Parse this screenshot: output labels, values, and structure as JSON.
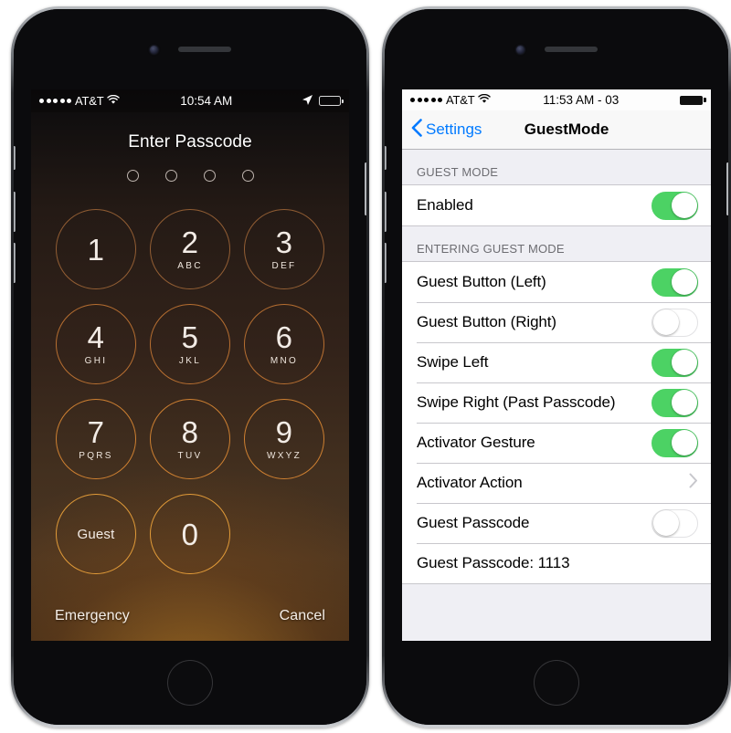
{
  "left_phone": {
    "status_bar": {
      "signal_dots": 5,
      "carrier": "AT&T",
      "wifi_icon": "wifi-icon",
      "time": "10:54 AM",
      "location_icon": "location-arrow-icon",
      "battery_icon": "battery-icon"
    },
    "lock_screen": {
      "title": "Enter Passcode",
      "passcode_dots": 4,
      "passcode_entered": 0,
      "keys": [
        {
          "num": "1",
          "letters": "",
          "row": 1
        },
        {
          "num": "2",
          "letters": "ABC",
          "row": 1
        },
        {
          "num": "3",
          "letters": "DEF",
          "row": 1
        },
        {
          "num": "4",
          "letters": "GHI",
          "row": 2
        },
        {
          "num": "5",
          "letters": "JKL",
          "row": 2
        },
        {
          "num": "6",
          "letters": "MNO",
          "row": 2
        },
        {
          "num": "7",
          "letters": "PQRS",
          "row": 3
        },
        {
          "num": "8",
          "letters": "TUV",
          "row": 3
        },
        {
          "num": "9",
          "letters": "WXYZ",
          "row": 3
        },
        {
          "num": "Guest",
          "letters": "",
          "row": 4,
          "guest": true
        },
        {
          "num": "0",
          "letters": "",
          "row": 4
        }
      ],
      "emergency_label": "Emergency",
      "cancel_label": "Cancel"
    }
  },
  "right_phone": {
    "status_bar": {
      "signal_dots": 5,
      "carrier": "AT&T",
      "wifi_icon": "wifi-icon",
      "time": "11:53 AM - 03",
      "battery_icon": "battery-icon"
    },
    "navbar": {
      "back_label": "Settings",
      "back_icon": "chevron-left-icon",
      "title": "GuestMode"
    },
    "sections": [
      {
        "header": "GUEST MODE",
        "rows": [
          {
            "label": "Enabled",
            "control": "switch",
            "value": "on"
          }
        ]
      },
      {
        "header": "ENTERING GUEST MODE",
        "rows": [
          {
            "label": "Guest Button (Left)",
            "control": "switch",
            "value": "on"
          },
          {
            "label": "Guest Button (Right)",
            "control": "switch",
            "value": "off"
          },
          {
            "label": "Swipe Left",
            "control": "switch",
            "value": "on"
          },
          {
            "label": "Swipe Right (Past Passcode)",
            "control": "switch",
            "value": "on"
          },
          {
            "label": "Activator Gesture",
            "control": "switch",
            "value": "on"
          },
          {
            "label": "Activator Action",
            "control": "disclosure",
            "value": ""
          },
          {
            "label": "Guest Passcode",
            "control": "switch",
            "value": "off"
          },
          {
            "label": "Guest Passcode: 1113",
            "control": "none",
            "value": ""
          }
        ]
      }
    ]
  },
  "colors": {
    "switch_on": "#4cd264",
    "switch_off": "#ffffff",
    "tint_blue": "#007aff",
    "settings_bg": "#efeff4",
    "keypad_ring": "#d68840"
  }
}
